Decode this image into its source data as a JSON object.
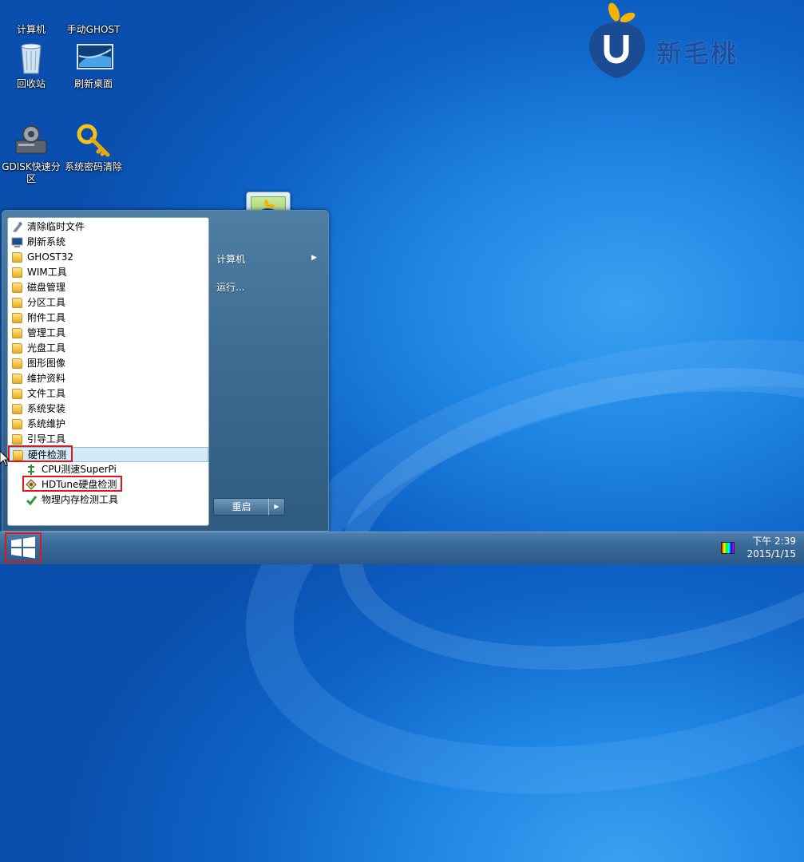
{
  "desktop": {
    "icons": [
      {
        "label": "计算机",
        "name": "computer"
      },
      {
        "label": "手动GHOST",
        "name": "manual-ghost"
      },
      {
        "label": "回收站",
        "name": "recycle-bin"
      },
      {
        "label": "刷新桌面",
        "name": "refresh-desktop"
      },
      {
        "label": "GDISK快速分区",
        "name": "gdisk-quick-partition"
      },
      {
        "label": "系统密码清除",
        "name": "system-password-clear"
      }
    ],
    "logo_text": "新毛桃",
    "brand_color": "#1e4f9c"
  },
  "start_menu": {
    "programs": [
      {
        "label": "清除临时文件",
        "icon": "cleanup-icon"
      },
      {
        "label": "刷新系统",
        "icon": "refresh-system-icon"
      },
      {
        "label": "GHOST32",
        "icon": "folder-icon"
      },
      {
        "label": "WIM工具",
        "icon": "folder-icon"
      },
      {
        "label": "磁盘管理",
        "icon": "folder-icon"
      },
      {
        "label": "分区工具",
        "icon": "folder-icon"
      },
      {
        "label": "附件工具",
        "icon": "folder-icon"
      },
      {
        "label": "管理工具",
        "icon": "folder-icon"
      },
      {
        "label": "光盘工具",
        "icon": "folder-icon"
      },
      {
        "label": "图形图像",
        "icon": "folder-icon"
      },
      {
        "label": "维护资料",
        "icon": "folder-icon"
      },
      {
        "label": "文件工具",
        "icon": "folder-icon"
      },
      {
        "label": "系统安装",
        "icon": "folder-icon"
      },
      {
        "label": "系统维护",
        "icon": "folder-icon"
      },
      {
        "label": "引导工具",
        "icon": "folder-icon"
      },
      {
        "label": "硬件检测",
        "icon": "folder-icon"
      }
    ],
    "sub_items": [
      {
        "label": "CPU测速SuperPi",
        "icon": "cpu-icon"
      },
      {
        "label": "HDTune硬盘检测",
        "icon": "hdtune-icon"
      },
      {
        "label": "物理内存检测工具",
        "icon": "memory-test-icon"
      }
    ],
    "right": {
      "computer_label": "计算机",
      "run_label": "运行...",
      "restart_label": "重启"
    }
  },
  "taskbar": {
    "time": "下午 2:39",
    "date": "2015/1/15"
  },
  "colors": {
    "highlight_box": "#e0161b",
    "desktop_blue": "#1f86e4"
  }
}
